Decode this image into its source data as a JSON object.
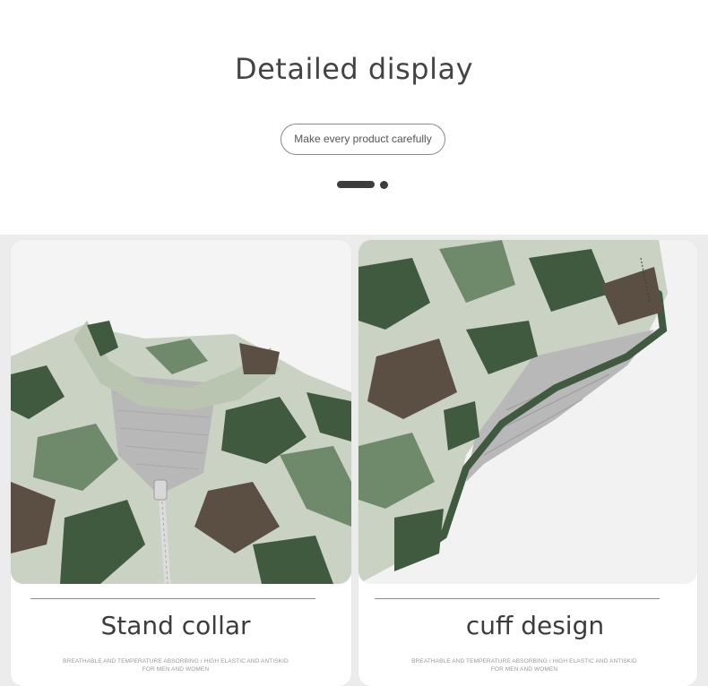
{
  "header": {
    "title": "Detailed display",
    "pill": "Make every product carefully"
  },
  "cards": [
    {
      "title": "Stand collar",
      "sub_line1": "BREATHABLE AND TEMPERATURE ABSORBING / HIGH ELASTIC AND ANTISKID",
      "sub_line2": "FOR MEN AND WOMEN"
    },
    {
      "title": "cuff design",
      "sub_line1": "BREATHABLE AND TEMPERATURE ABSORBING / HIGH ELASTIC AND ANTISKID",
      "sub_line2": "FOR MEN AND WOMEN"
    }
  ],
  "colors": {
    "camo_light": "#c9d2c3",
    "camo_mid": "#6f8a6a",
    "camo_dark": "#3f5a3f",
    "camo_brown": "#5b4f43",
    "mesh": "#b8b8b8"
  }
}
